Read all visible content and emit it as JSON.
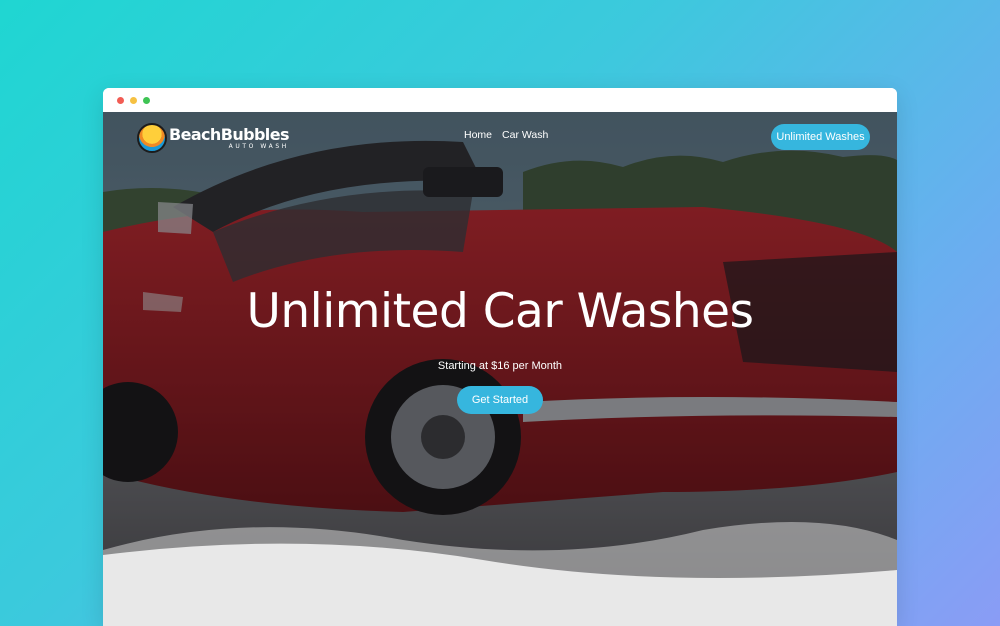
{
  "window": {
    "controls": [
      "close",
      "minimize",
      "maximize"
    ]
  },
  "brand": {
    "name": "BeachBubbles",
    "tagline": "AUTO WASH",
    "logo_icon": "beach-car-badge-icon"
  },
  "nav": {
    "links": [
      {
        "label": "Home"
      },
      {
        "label": "Car Wash"
      }
    ],
    "cta_label": "Unlimited Washes"
  },
  "hero": {
    "title": "Unlimited Car Washes",
    "subtitle": "Starting at $16 per Month",
    "cta_label": "Get Started",
    "background": "red-convertible-car-photo"
  },
  "colors": {
    "accent": "#36b6de",
    "page_gradient_start": "#1fd6d2",
    "page_gradient_end": "#8a9cf5",
    "wave_light": "#e8e8e8",
    "wave_mid": "#cfcfcf"
  }
}
